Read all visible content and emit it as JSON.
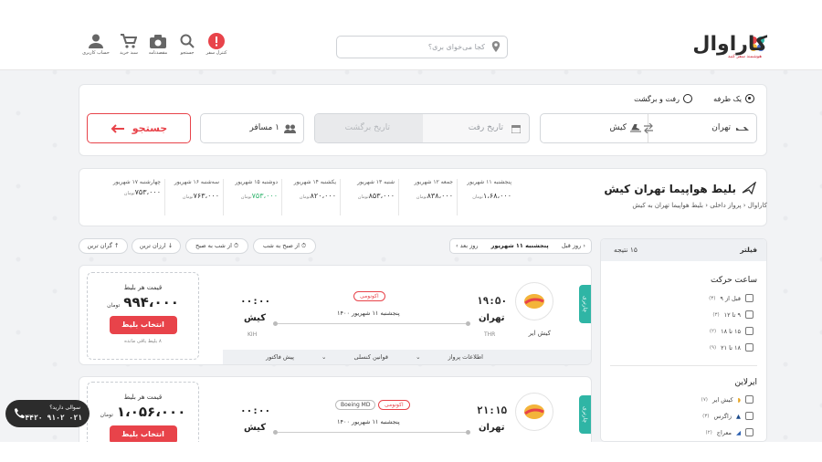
{
  "header": {
    "logo": "کاراوال",
    "logo_sub": "هوشمند سفر کنید",
    "search_placeholder": "کجا می‌خوای بری؟",
    "icons": [
      {
        "label": "کنترل سفر",
        "icon": "alert-icon"
      },
      {
        "label": "جستجو",
        "icon": "search-icon"
      },
      {
        "label": "مقصدنامه",
        "icon": "camera-icon"
      },
      {
        "label": "سبد خرید",
        "icon": "cart-icon"
      },
      {
        "label": "حساب کاربری",
        "icon": "user-icon"
      }
    ]
  },
  "search_panel": {
    "trip_one_way": "یک طرفه",
    "trip_round": "رفت و برگشت",
    "origin": "تهران",
    "destination": "کیش",
    "depart_placeholder": "تاریخ رفت",
    "return_placeholder": "تاریخ برگشت",
    "passengers": "۱ مسافر",
    "search_button": "جستجو"
  },
  "page": {
    "title": "بلیط هواپیما تهران کیش",
    "breadcrumb": [
      "کاراوال",
      "پرواز داخلی",
      "بلیط هواپیما تهران به کیش"
    ],
    "days": [
      {
        "date": "پنجشنبه ۱۱ شهریور",
        "price": "۱،۶۸،۰۰۰",
        "unit": "تومان",
        "selected": false
      },
      {
        "date": "جمعه ۱۲ شهریور",
        "price": "۸۳۸،۰۰۰",
        "unit": "تومان",
        "selected": false
      },
      {
        "date": "شنبه ۱۳ شهریور",
        "price": "۸۵۳،۰۰۰",
        "unit": "تومان",
        "selected": false
      },
      {
        "date": "یکشنبه ۱۴ شهریور",
        "price": "۸۲۰،۰۰۰",
        "unit": "تومان",
        "selected": false
      },
      {
        "date": "دوشنبه ۱۵ شهریور",
        "price": "۷۵۳،۰۰۰",
        "unit": "تومان",
        "selected": true
      },
      {
        "date": "سه‌شنبه ۱۶ شهریور",
        "price": "۷۶۳،۰۰۰",
        "unit": "تومان",
        "selected": false
      },
      {
        "date": "چهارشنبه ۱۷ شهریور",
        "price": "۷۵۳،۰۰۰",
        "unit": "تومان",
        "selected": false
      }
    ]
  },
  "toolbar": {
    "prev_day": "روز قبل",
    "current_day": "پنجشنبه ۱۱ شهریور",
    "next_day": "روز بعد",
    "sorts": [
      "از صبح به شب",
      "از شب به صبح",
      "ارزان ترین",
      "گران ترین"
    ]
  },
  "filter": {
    "title": "فیلتر",
    "count": "۱۵ نتیجه",
    "time_title": "ساعت حرکت",
    "times": [
      {
        "label": "قبل از ۹",
        "count": "(۳)"
      },
      {
        "label": "۹ تا ۱۲",
        "count": "(۳)"
      },
      {
        "label": "۱۵ تا ۱۸",
        "count": "(۲)"
      },
      {
        "label": "۱۸ تا ۲۱",
        "count": "(۹)"
      }
    ],
    "airline_title": "ایرلاین",
    "airlines": [
      {
        "label": "کیش ایر",
        "count": "(۷)"
      },
      {
        "label": "زاگرس",
        "count": "(۳)"
      },
      {
        "label": "معراج",
        "count": "(۲)"
      }
    ]
  },
  "flights": [
    {
      "type_tag": "چارتری",
      "airline": "کیش ایر",
      "depart_time": "۱۹:۵۰",
      "depart_city": "تهران",
      "depart_code": "THR",
      "arrive_time": "۰۰:۰۰",
      "arrive_city": "کیش",
      "arrive_code": "KIH",
      "class": "اکونومی",
      "aircraft": "",
      "date": "پنجشنبه ۱۱ شهریور ۱۴۰۰",
      "price_label": "قیمت هر بلیط",
      "price": "۹۹۴،۰۰۰",
      "currency": "تومان",
      "select": "انتخاب بلیط",
      "remaining": "۸ بلیط باقی مانده",
      "footer": [
        "اطلاعات پرواز",
        "قوانین کنسلی",
        "پیش فاکتور"
      ]
    },
    {
      "type_tag": "چارتری",
      "airline": "",
      "depart_time": "۲۱:۱۵",
      "depart_city": "تهران",
      "depart_code": "",
      "arrive_time": "۰۰:۰۰",
      "arrive_city": "کیش",
      "arrive_code": "",
      "class": "اکونومی",
      "aircraft": "Boeing MD",
      "date": "پنجشنبه ۱۱ شهریور ۱۴۰۰",
      "price_label": "قیمت هر بلیط",
      "price": "۱،۰۵۶،۰۰۰",
      "currency": "تومان",
      "select": "انتخاب بلیط",
      "remaining": "",
      "footer": []
    }
  ],
  "support": {
    "label": "سوالی دارید؟",
    "phone": "۰۲۱ ۹۱۰۲ ۴۴۲۰"
  },
  "colors": {
    "accent": "#e8434a",
    "teal": "#2fb5a5",
    "green": "#2db36b"
  }
}
